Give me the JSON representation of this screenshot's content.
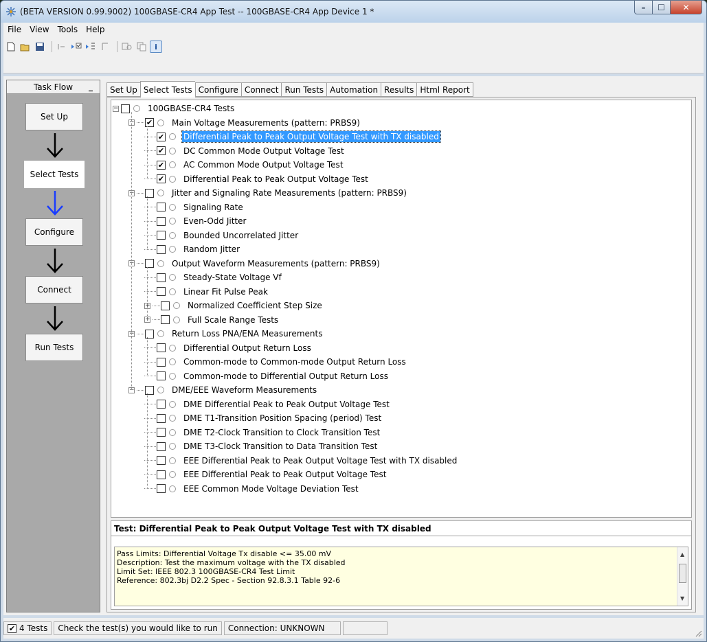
{
  "window": {
    "title": "(BETA VERSION 0.99.9002) 100GBASE-CR4 App Test -- 100GBASE-CR4 App Device 1 *",
    "buttons": {
      "minimize": "–",
      "maximize": "☐",
      "close": "✕"
    }
  },
  "menu": [
    "File",
    "View",
    "Tools",
    "Help"
  ],
  "toolbar_icons": [
    "new-file-icon",
    "open-folder-icon",
    "save-icon",
    "run-icon",
    "run-selected-icon",
    "step-icon",
    "pause-icon",
    "copy-icon",
    "paste-icon",
    "info-icon"
  ],
  "taskflow": {
    "header": "Task Flow",
    "min": "_",
    "steps": [
      "Set Up",
      "Select Tests",
      "Configure",
      "Connect",
      "Run Tests"
    ],
    "arrow_colors": [
      "#000000",
      "#1a3dff",
      "#000000",
      "#000000"
    ]
  },
  "tabs": [
    "Set Up",
    "Select Tests",
    "Configure",
    "Connect",
    "Run Tests",
    "Automation",
    "Results",
    "Html Report"
  ],
  "tree": {
    "root": {
      "label": "100GBASE-CR4 Tests",
      "checked": false
    },
    "groups": [
      {
        "label": "Main Voltage Measurements (pattern: PRBS9)",
        "checked": true,
        "items": [
          {
            "label": "Differential Peak to Peak Output Voltage Test with TX disabled",
            "checked": true,
            "selected": true
          },
          {
            "label": "DC Common Mode Output Voltage Test",
            "checked": true
          },
          {
            "label": "AC Common Mode Output Voltage Test",
            "checked": true
          },
          {
            "label": "Differential Peak to Peak Output Voltage Test",
            "checked": true
          }
        ]
      },
      {
        "label": "Jitter and Signaling Rate Measurements (pattern: PRBS9)",
        "checked": false,
        "items": [
          {
            "label": "Signaling Rate",
            "checked": false
          },
          {
            "label": "Even-Odd Jitter",
            "checked": false
          },
          {
            "label": "Bounded Uncorrelated Jitter",
            "checked": false
          },
          {
            "label": "Random Jitter",
            "checked": false
          }
        ]
      },
      {
        "label": "Output Waveform Measurements (pattern: PRBS9)",
        "checked": false,
        "items": [
          {
            "label": "Steady-State Voltage Vf",
            "checked": false
          },
          {
            "label": "Linear Fit Pulse Peak",
            "checked": false
          },
          {
            "label": "Normalized Coefficient Step Size",
            "checked": false,
            "expandable": true
          },
          {
            "label": "Full Scale Range Tests",
            "checked": false,
            "expandable": true
          }
        ]
      },
      {
        "label": "Return Loss PNA/ENA Measurements",
        "checked": false,
        "items": [
          {
            "label": "Differential Output Return Loss",
            "checked": false
          },
          {
            "label": "Common-mode to Common-mode Output Return Loss",
            "checked": false
          },
          {
            "label": "Common-mode to Differential Output Return Loss",
            "checked": false
          }
        ]
      },
      {
        "label": "DME/EEE Waveform Measurements",
        "checked": false,
        "items": [
          {
            "label": "DME Differential Peak to Peak Output Voltage Test",
            "checked": false
          },
          {
            "label": "DME T1-Transition Position Spacing (period) Test",
            "checked": false
          },
          {
            "label": "DME T2-Clock Transition to Clock Transition Test",
            "checked": false
          },
          {
            "label": "DME T3-Clock Transition to Data Transition Test",
            "checked": false
          },
          {
            "label": "EEE Differential Peak to Peak Output Voltage Test with TX disabled",
            "checked": false
          },
          {
            "label": "EEE Differential Peak to Peak Output Voltage Test",
            "checked": false
          },
          {
            "label": "EEE Common Mode Voltage Deviation Test",
            "checked": false
          }
        ]
      }
    ]
  },
  "details": {
    "title": "Test: Differential Peak to Peak Output Voltage Test with TX disabled",
    "lines": [
      "Pass Limits: Differential Voltage Tx disable <= 35.00 mV",
      "Description: Test the maximum voltage with the TX disabled",
      "Limit Set: IEEE 802.3 100GBASE-CR4 Test Limit",
      "Reference: 802.3bj D2.2 Spec - Section 92.8.3.1 Table 92-6"
    ]
  },
  "status": {
    "tests": "4 Tests",
    "tests_checked": true,
    "hint": "Check the test(s) you would like to run",
    "connection": "Connection: UNKNOWN",
    "extra": ""
  }
}
